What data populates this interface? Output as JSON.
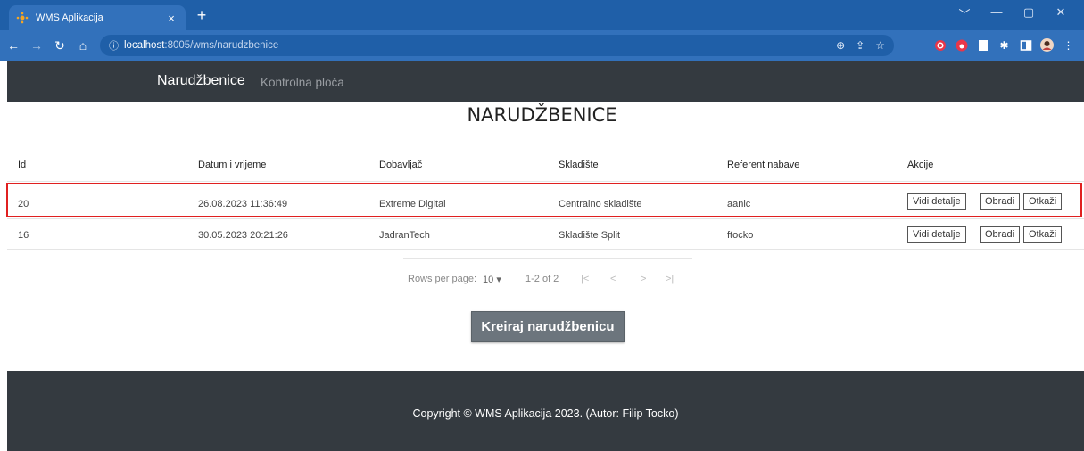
{
  "browser": {
    "tab_title": "WMS Aplikacija",
    "tab_close": "×",
    "new_tab": "+",
    "url_host": "localhost",
    "url_path": ":8005/wms/narudzbenice",
    "window_controls": [
      "﹀",
      "—",
      "▢",
      "✕"
    ]
  },
  "navbar": {
    "brand": "Narudžbenice",
    "link": "Kontrolna ploča"
  },
  "page": {
    "title": "NARUDŽBENICE"
  },
  "table": {
    "headers": [
      "Id",
      "Datum i vrijeme",
      "Dobavljač",
      "Skladište",
      "Referent nabave",
      "Akcije"
    ],
    "rows": [
      {
        "id": "20",
        "datetime": "26.08.2023 11:36:49",
        "supplier": "Extreme Digital",
        "warehouse": "Centralno skladište",
        "referent": "aanic"
      },
      {
        "id": "16",
        "datetime": "30.05.2023 20:21:26",
        "supplier": "JadranTech",
        "warehouse": "Skladište Split",
        "referent": "ftocko"
      }
    ],
    "actions": {
      "details": "Vidi detalje",
      "process": "Obradi",
      "cancel": "Otkaži"
    }
  },
  "pagination": {
    "rows_label": "Rows per page:",
    "rows_value": "10",
    "range": "1-2 of 2"
  },
  "create_button": "Kreiraj narudžbenicu",
  "footer": {
    "text": "Copyright © WMS Aplikacija 2023. (Autor: Filip Tocko)"
  }
}
